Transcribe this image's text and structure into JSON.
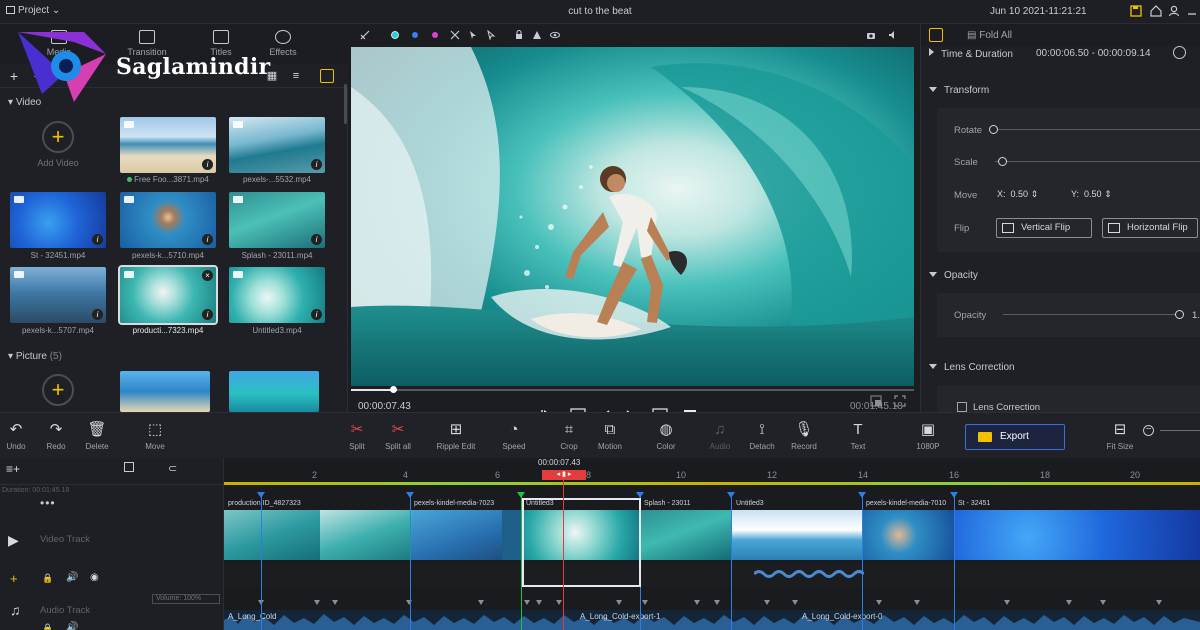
{
  "topbar": {
    "project_label": "Project",
    "title": "cut to the beat",
    "datetime": "Jun 10 2021-11:21:21"
  },
  "media": {
    "tabs": [
      {
        "label": "Media"
      },
      {
        "label": "Transition"
      },
      {
        "label": "Titles"
      },
      {
        "label": "Effects"
      }
    ],
    "video_section": {
      "label": "Video"
    },
    "add_video_label": "Add Video",
    "video_items": [
      {
        "label": "Free Foo...3871.mp4",
        "imported": true
      },
      {
        "label": "pexels-...5532.mp4"
      },
      {
        "label": "St - 32451.mp4"
      },
      {
        "label": "pexels-k...5710.mp4"
      },
      {
        "label": "Splash - 23011.mp4"
      },
      {
        "label": "pexels-k...5707.mp4"
      },
      {
        "label": "producti...7323.mp4",
        "selected": true
      },
      {
        "label": "Untitled3.mp4"
      }
    ],
    "picture_section": {
      "label": "Picture",
      "count": "(5)"
    }
  },
  "watermark": {
    "text": "Saglamindir"
  },
  "preview": {
    "current_time": "00:00:07.43",
    "total_time": "00:01:45.18"
  },
  "properties": {
    "fold_all_label": "Fold All",
    "time_duration": {
      "label": "Time & Duration",
      "value": "00:00:06.50 - 00:00:09.14"
    },
    "transform": {
      "label": "Transform",
      "rotate_label": "Rotate",
      "scale_label": "Scale",
      "move_label": "Move",
      "move_x_label": "X:",
      "move_x": "0.50",
      "move_y_label": "Y:",
      "move_y": "0.50",
      "flip_label": "Flip",
      "vertical_flip": "Vertical Flip",
      "horizontal_flip": "Horizontal Flip"
    },
    "opacity": {
      "section_label": "Opacity",
      "label": "Opacity",
      "value": "1."
    },
    "lens": {
      "section_label": "Lens Correction",
      "checkbox_label": "Lens Correction"
    }
  },
  "toolbar": {
    "undo": "Undo",
    "redo": "Redo",
    "delete": "Delete",
    "move": "Move",
    "split": "Split",
    "split_all": "Split all",
    "ripple_edit": "Ripple Edit",
    "speed": "Speed",
    "crop": "Crop",
    "motion": "Motion",
    "color": "Color",
    "audio": "Audio",
    "detach": "Detach",
    "record": "Record",
    "text": "Text",
    "resolution": "1080P",
    "export": "Export",
    "fit_size": "Fit Size"
  },
  "timeline": {
    "duration_label": "Duration: 00:01:45.18",
    "playhead_time": "00:00:07.43",
    "ruler": [
      "2",
      "4",
      "6",
      "8",
      "10",
      "12",
      "14",
      "16",
      "18",
      "20"
    ],
    "video_track_label": "Video Track",
    "audio_track_label": "Audio Track",
    "volume_label": "Volume: 100%",
    "clip_labels": [
      "production ID_4827323",
      "pexels-kindel-media-7023",
      "Untitled3",
      "Splash - 23011",
      "Untitled3",
      "pexels-kindel-media-7010",
      "St - 32451"
    ],
    "audio_clips": [
      "A_Long_Cold",
      "A_Long_Cold-export-1",
      "A_Long_Cold-export-0"
    ]
  },
  "colors": {
    "accent_blue": "#2f7ee6",
    "playhead_red": "#e23c3c",
    "accent_yellow": "#f2c200",
    "beat_green": "#23c04b"
  }
}
